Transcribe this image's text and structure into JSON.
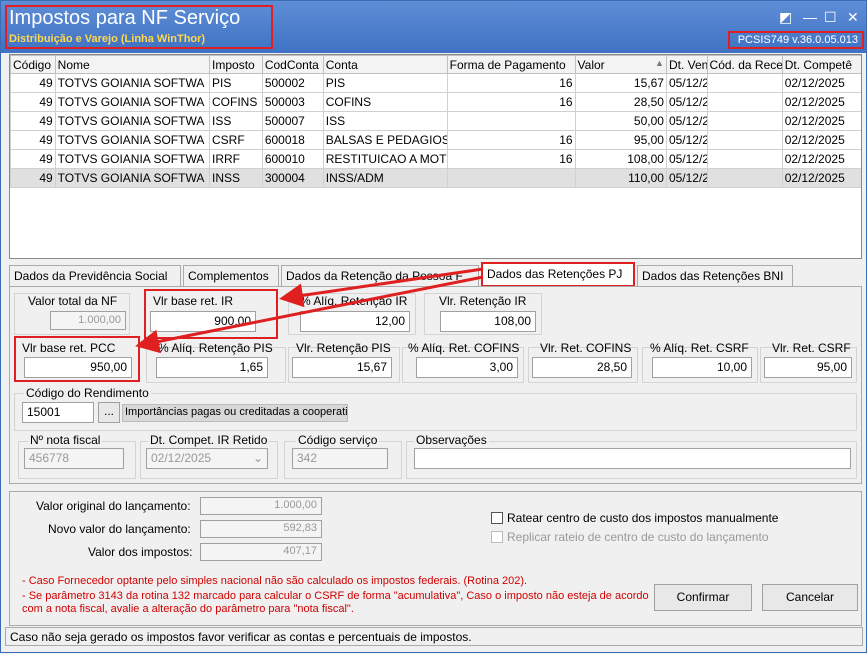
{
  "window": {
    "title": "Impostos para NF Serviço",
    "subtitle": "Distribuição e Varejo (Linha WinThor)",
    "version": "PCSIS749  v.36.0.05.013"
  },
  "grid": {
    "columns": [
      "Código",
      "Nome",
      "Imposto",
      "CodConta",
      "Conta",
      "Forma de Pagamento",
      "Valor",
      "Dt. Venc",
      "Cód. da Rece",
      "Dt. Competê"
    ],
    "rows": [
      {
        "codigo": "49",
        "nome": "TOTVS GOIANIA SOFTWA",
        "imposto": "PIS",
        "codconta": "500002",
        "conta": "PIS",
        "forma": "16",
        "valor": "15,67",
        "venc": "05/12/2",
        "rece": "",
        "comp": "02/12/2025"
      },
      {
        "codigo": "49",
        "nome": "TOTVS GOIANIA SOFTWA",
        "imposto": "COFINS",
        "codconta": "500003",
        "conta": "COFINS",
        "forma": "16",
        "valor": "28,50",
        "venc": "05/12/2",
        "rece": "",
        "comp": "02/12/2025"
      },
      {
        "codigo": "49",
        "nome": "TOTVS GOIANIA SOFTWA",
        "imposto": "ISS",
        "codconta": "500007",
        "conta": "ISS",
        "forma": "",
        "valor": "50,00",
        "venc": "05/12/2",
        "rece": "",
        "comp": "02/12/2025"
      },
      {
        "codigo": "49",
        "nome": "TOTVS GOIANIA SOFTWA",
        "imposto": "CSRF",
        "codconta": "600018",
        "conta": "BALSAS E PEDAGIOS",
        "forma": "16",
        "valor": "95,00",
        "venc": "05/12/2",
        "rece": "",
        "comp": "02/12/2025"
      },
      {
        "codigo": "49",
        "nome": "TOTVS GOIANIA SOFTWA",
        "imposto": "IRRF",
        "codconta": "600010",
        "conta": "RESTITUICAO A MOT",
        "forma": "16",
        "valor": "108,00",
        "venc": "05/12/2",
        "rece": "",
        "comp": "02/12/2025"
      },
      {
        "codigo": "49",
        "nome": "TOTVS GOIANIA SOFTWA",
        "imposto": "INSS",
        "codconta": "300004",
        "conta": "INSS/ADM",
        "forma": "",
        "valor": "110,00",
        "venc": "05/12/2",
        "rece": "",
        "comp": "02/12/2025"
      }
    ]
  },
  "tabs": [
    {
      "label": "Dados da Previdência Social"
    },
    {
      "label": "Complementos"
    },
    {
      "label": "Dados da Retenção da Pessoa F"
    },
    {
      "label": "Dados das Retenções PJ"
    },
    {
      "label": "Dados das Retenções BNI"
    }
  ],
  "pj": {
    "valor_total_label": "Valor total da NF",
    "valor_total": "1.000,00",
    "base_ir_label": "Vlr base ret. IR",
    "base_ir": "900,00",
    "aliq_ir_label": "% Alíq. Retenção IR",
    "aliq_ir": "12,00",
    "ret_ir_label": "Vlr. Retenção IR",
    "ret_ir": "108,00",
    "base_pcc_label": "Vlr base ret. PCC",
    "base_pcc": "950,00",
    "aliq_pis_label": "% Alíq. Retenção PIS",
    "aliq_pis": "1,65",
    "ret_pis_label": "Vlr. Retenção PIS",
    "ret_pis": "15,67",
    "aliq_cofins_label": "% Alíq. Ret. COFINS",
    "aliq_cofins": "3,00",
    "ret_cofins_label": "Vlr. Ret. COFINS",
    "ret_cofins": "28,50",
    "aliq_csrf_label": "% Alíq. Ret. CSRF",
    "aliq_csrf": "10,00",
    "ret_csrf_label": "Vlr. Ret. CSRF",
    "ret_csrf": "95,00",
    "cod_rend_label": "Código do Rendimento",
    "cod_rend": "15001",
    "cod_rend_btn": "...",
    "cod_rend_desc": "Importâncias pagas ou creditadas a cooperativ",
    "nf_label": "Nº nota fiscal",
    "nf": "456778",
    "compet_label": "Dt. Compet. IR Retido",
    "compet": "02/12/2025",
    "cod_serv_label": "Código serviço",
    "cod_serv": "342",
    "obs_label": "Observações",
    "obs": ""
  },
  "footer": {
    "orig_label": "Valor original do lançamento:",
    "orig": "1.000,00",
    "novo_label": "Novo valor do lançamento:",
    "novo": "592,83",
    "imp_label": "Valor dos impostos:",
    "imp": "407,17",
    "ratear_label": "Ratear centro de custo dos impostos manualmente",
    "replicar_label": "Replicar rateio de centro de custo do lançamento",
    "note1": "- Caso Fornecedor optante pelo simples nacional não são calculado os impostos federais. (Rotina 202).",
    "note2": "- Se parâmetro 3143 da rotina 132 marcado para calcular o CSRF de forma \"acumulativa\", Caso o imposto não esteja de acordo",
    "note3": "com a nota fiscal, avalie a alteração do parâmetro para \"nota fiscal\".",
    "confirm": "Confirmar",
    "cancel": "Cancelar"
  },
  "status": "Caso não seja gerado os impostos favor verificar as contas e percentuais de impostos."
}
